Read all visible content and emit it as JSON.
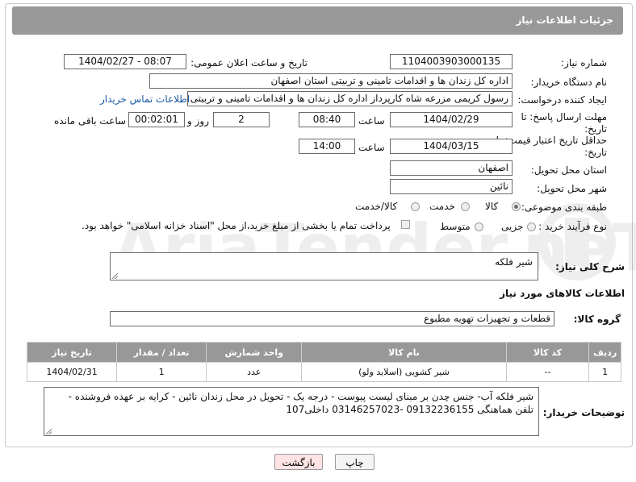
{
  "header": {
    "title": "جزئیات اطلاعات نیاز"
  },
  "fields": {
    "need_number_label": "شماره نیاز:",
    "need_number": "1104003903000135",
    "announce_label": "تاریخ و ساعت اعلان عمومی:",
    "announce_value": "1404/02/27 - 08:07",
    "buyer_org_label": "نام دستگاه خریدار:",
    "buyer_org": "اداره کل زندان ها و اقدامات تامینی و تربیتی استان اصفهان",
    "creator_label": "ایجاد کننده درخواست:",
    "creator": "رسول کریمی مزرعه شاه کارپرداز اداره کل زندان ها و اقدامات تامینی و تربیتی ا",
    "contact_link": "اطلاعات تماس خریدار",
    "deadline_label": "مهلت ارسال پاسخ: تا تاریخ:",
    "deadline_date": "1404/02/29",
    "time_label": "ساعت",
    "deadline_time": "08:40",
    "days_value": "2",
    "days_label": "روز و",
    "remaining_value": "00:02:01",
    "remaining_label": "ساعت باقی مانده",
    "price_valid_label": "حداقل تاریخ اعتبار قیمت: تا تاریخ:",
    "price_valid_date": "1404/03/15",
    "price_valid_time": "14:00",
    "province_label": "استان محل تحویل:",
    "province": "اصفهان",
    "city_label": "شهر محل تحویل:",
    "city": "نائین",
    "category_label": "طبقه بندی موضوعی:",
    "category_options": [
      "کالا",
      "خدمت",
      "کالا/خدمت"
    ],
    "process_label": "نوع فرآیند خرید :",
    "process_options": [
      "جزیی",
      "متوسط"
    ],
    "payment_note": "پرداخت تمام یا بخشی از مبلغ خرید،از محل \"اسناد خزانه اسلامی\" خواهد بود."
  },
  "summary": {
    "label": "شرح کلی نیاز:",
    "value": "شیر فلکه"
  },
  "goods": {
    "section_title": "اطلاعات کالاهای مورد نیاز",
    "group_label": "گروه کالا:",
    "group_value": "قطعات و تجهیزات تهویه مطبوع",
    "columns": [
      "ردیف",
      "کد کالا",
      "نام کالا",
      "واحد شمارش",
      "تعداد / مقدار",
      "تاریخ نیاز"
    ],
    "rows": [
      {
        "row": "1",
        "code": "--",
        "name": "شیر کشویی (اسلاید ولو)",
        "unit": "عدد",
        "qty": "1",
        "date": "1404/02/31"
      }
    ]
  },
  "buyer_notes": {
    "label": "توضیحات خریدار:",
    "value": "شیر فلکه آب- جنس چدن بر مبنای لیست پیوست - درجه یک - تحویل در محل زندان نائین - کرایه بر عهده فروشنده - تلفن هماهنگی 09132236155 -03146257023 داخلی107"
  },
  "buttons": {
    "print": "چاپ",
    "back": "بازگشت"
  },
  "watermark": {
    "text": "AriaTender.neT"
  },
  "colors": {
    "header_bg": "#989898",
    "link": "#1a5aa6",
    "back_button_bg": "#fde3e3"
  }
}
